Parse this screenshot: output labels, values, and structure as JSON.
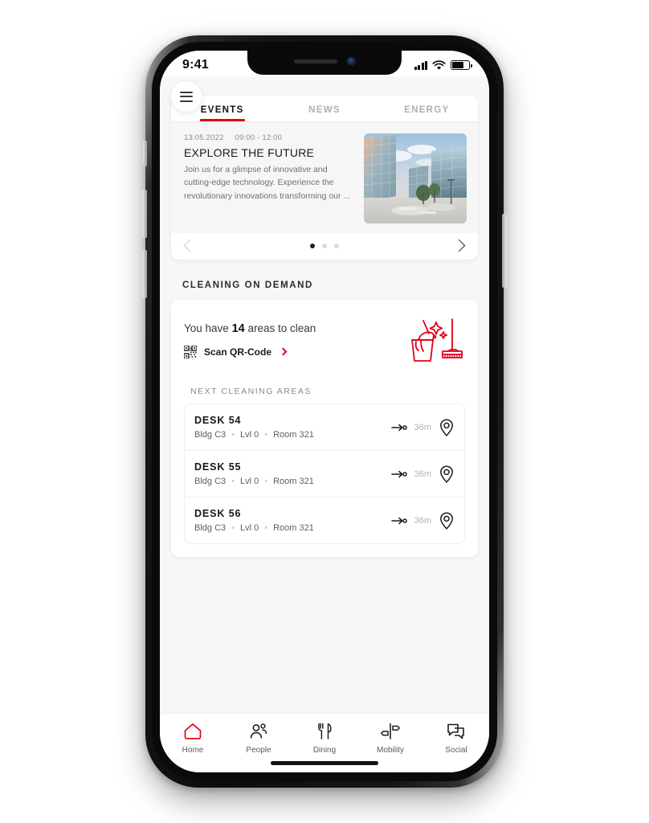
{
  "statusbar": {
    "time": "9:41",
    "cellular_icon": "cellular-bars-icon",
    "wifi_icon": "wifi-icon",
    "battery_icon": "battery-icon",
    "battery_level_pct": 72
  },
  "header": {
    "menu_icon": "hamburger-menu-icon"
  },
  "tabs": [
    {
      "label": "EVENTS",
      "active": true
    },
    {
      "label": "NEWS",
      "active": false
    },
    {
      "label": "ENERGY",
      "active": false
    }
  ],
  "event": {
    "date": "13.05.2022",
    "time": "09:00 - 12:00",
    "title": "EXPLORE THE FUTURE",
    "description": "Join us for a glimpse of innovative and cutting-edge technology. Experience the revolutionary innovations transforming our ...",
    "image_alt": "modern glass office buildings plaza at sunset"
  },
  "carousel": {
    "prev_icon": "chevron-left-icon",
    "next_icon": "chevron-right-icon",
    "total_dots": 3,
    "active_dot": 1
  },
  "cleaning": {
    "section_title": "CLEANING ON DEMAND",
    "headline_prefix": "You have",
    "count": "14",
    "headline_suffix": "areas to clean",
    "scan_icon": "qr-code-icon",
    "scan_label": "Scan QR-Code",
    "scan_chevron_icon": "chevron-right-icon",
    "illustration_icon": "cleaning-bucket-broom-icon",
    "next_areas_title": "NEXT CLEANING AREAS",
    "areas": [
      {
        "name": "DESK 54",
        "building": "Bldg C3",
        "level": "Lvl 0",
        "room": "Room 321",
        "route_icon": "route-arrow-icon",
        "distance": "36m",
        "pin_icon": "map-pin-icon"
      },
      {
        "name": "DESK 55",
        "building": "Bldg C3",
        "level": "Lvl 0",
        "room": "Room 321",
        "route_icon": "route-arrow-icon",
        "distance": "36m",
        "pin_icon": "map-pin-icon"
      },
      {
        "name": "DESK 56",
        "building": "Bldg C3",
        "level": "Lvl 0",
        "room": "Room 321",
        "route_icon": "route-arrow-icon",
        "distance": "36m",
        "pin_icon": "map-pin-icon"
      }
    ]
  },
  "bottom_nav": [
    {
      "label": "Home",
      "icon": "home-icon",
      "active": true
    },
    {
      "label": "People",
      "icon": "people-icon",
      "active": false
    },
    {
      "label": "Dining",
      "icon": "fork-knife-icon",
      "active": false
    },
    {
      "label": "Mobility",
      "icon": "signpost-icon",
      "active": false
    },
    {
      "label": "Social",
      "icon": "chat-bubbles-icon",
      "active": false
    }
  ],
  "colors": {
    "accent_red": "#e2001a",
    "background": "#f7f7f7",
    "card": "#ffffff",
    "text_primary": "#161616",
    "text_muted": "#8a8a8a"
  }
}
